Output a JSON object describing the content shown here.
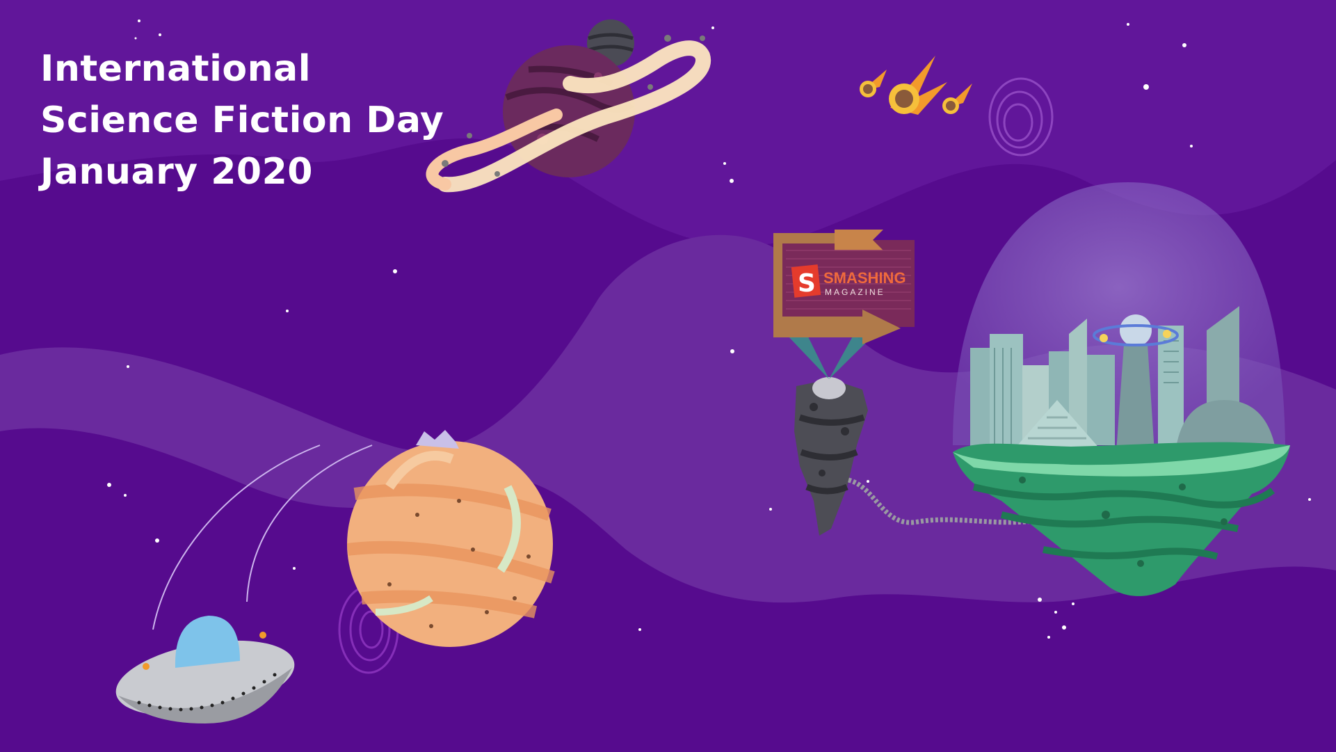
{
  "title": {
    "line1": "International",
    "line2": "Science Fiction Day",
    "line3": "January 2020"
  },
  "sign": {
    "logo_letter": "S",
    "brand": "SMASHING",
    "sub": "MAGAZINE"
  },
  "colors": {
    "background": "#560b8e",
    "wave_light": "#6a2a9e",
    "orange_planet": "#f2b07e",
    "green_island": "#2e9a6b",
    "sign_board": "#7a2a5a",
    "logo_red": "#e53b2c"
  }
}
